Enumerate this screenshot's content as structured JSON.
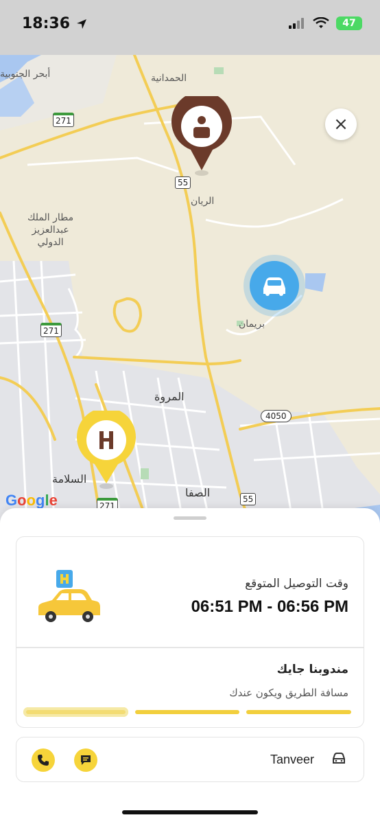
{
  "status_bar": {
    "time": "18:36",
    "battery": "47"
  },
  "map": {
    "labels": {
      "hamdaniya": "الحمدانية",
      "abhur": "أبحر الجنوبية",
      "airport": "مطار الملك\nعبدالعزيز\nالدولي",
      "rayyan": "الريان",
      "buraiman": "بريمان",
      "marwa": "المروة",
      "salama": "السلامة",
      "safa": "الصفا"
    },
    "road_shields": {
      "r271a": "271",
      "r271b": "271",
      "r271c": "271",
      "r55a": "55",
      "r55b": "55",
      "r4050": "4050"
    },
    "attribution": "Google",
    "colors": {
      "customer_pin": "#6b3a2a",
      "car_pin": "#47a9ea",
      "hotel_pin": "#f6d43a"
    }
  },
  "close_icon": "×",
  "delivery": {
    "eta_label": "وقت التوصيل المتوقع",
    "eta_value": "06:51 PM - 06:56 PM",
    "status_title": "مندوبنا جايك",
    "status_subtitle": "مسافة الطريق ويكون عندك",
    "progress_steps": 3,
    "active_step": 1,
    "accent_color": "#f6d43a"
  },
  "driver": {
    "name": "Tanveer"
  }
}
